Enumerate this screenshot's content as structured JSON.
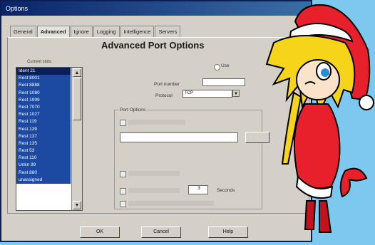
{
  "window": {
    "title": "Options"
  },
  "tabs": [
    "General",
    "Advanced",
    "Ignore",
    "Logging",
    "Intelligence",
    "Servers"
  ],
  "heading": "Advanced Port Options",
  "list": {
    "label": "Current slots",
    "items": [
      "Ident 21",
      "Rest 8001",
      "Rest 8888",
      "Rest 1080",
      "Rest 1999",
      "Rest 7070",
      "Rest 1027",
      "Rest 119",
      "Rest 139",
      "Rest 137",
      "Rest 135",
      "Rest 53",
      "Rest 110",
      "Unkn 99",
      "Rest 880",
      "unassigned"
    ]
  },
  "port_number": {
    "label": "Port number",
    "value": ""
  },
  "protocol": {
    "label": "Protocol",
    "value": "TCP"
  },
  "use_label": "Use",
  "port_options_title": "Port Options",
  "seconds_label": "Seconds",
  "seconds_value": "3",
  "buttons": {
    "ok": "OK",
    "cancel": "Cancel",
    "help": "Help"
  },
  "icons": {
    "scroll_up": "▲",
    "scroll_down": "▼",
    "dropdown": "▼"
  }
}
